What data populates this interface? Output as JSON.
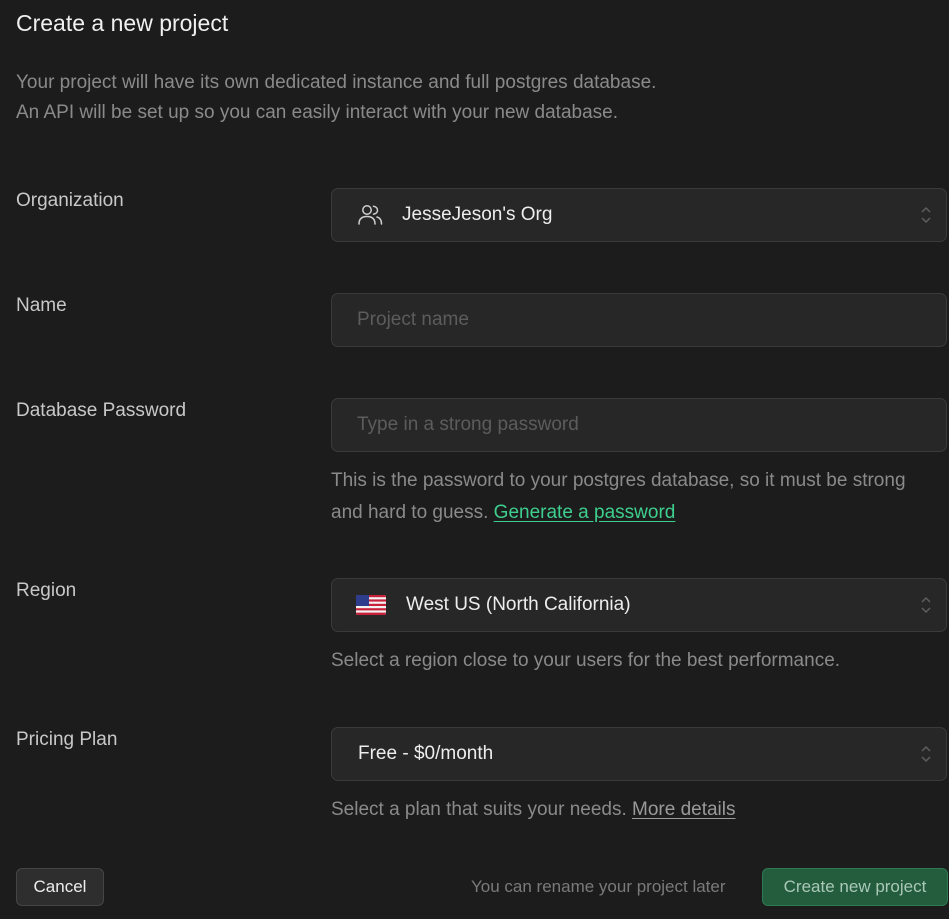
{
  "header": {
    "title": "Create a new project",
    "intro_line1": "Your project will have its own dedicated instance and full postgres database.",
    "intro_line2": "An API will be set up so you can easily interact with your new database."
  },
  "organization": {
    "label": "Organization",
    "value": "JesseJeson's Org",
    "icon": "users-icon"
  },
  "name": {
    "label": "Name",
    "value": "",
    "placeholder": "Project name"
  },
  "password": {
    "label": "Database Password",
    "value": "",
    "placeholder": "Type in a strong password",
    "help_text": "This is the password to your postgres database, so it must be strong and hard to guess.",
    "generate_link": "Generate a password"
  },
  "region": {
    "label": "Region",
    "value": "West US (North California)",
    "icon": "us-flag-icon",
    "help_text": "Select a region close to your users for the best performance."
  },
  "pricing": {
    "label": "Pricing Plan",
    "value": "Free - $0/month",
    "help_text": "Select a plan that suits your needs.",
    "details_link": "More details"
  },
  "footer": {
    "cancel_label": "Cancel",
    "note": "You can rename your project later",
    "create_label": "Create new project"
  },
  "colors": {
    "background": "#1c1c1c",
    "input_background": "#272727",
    "accent": "#3ecf8e",
    "primary_button": "#245c3e"
  }
}
